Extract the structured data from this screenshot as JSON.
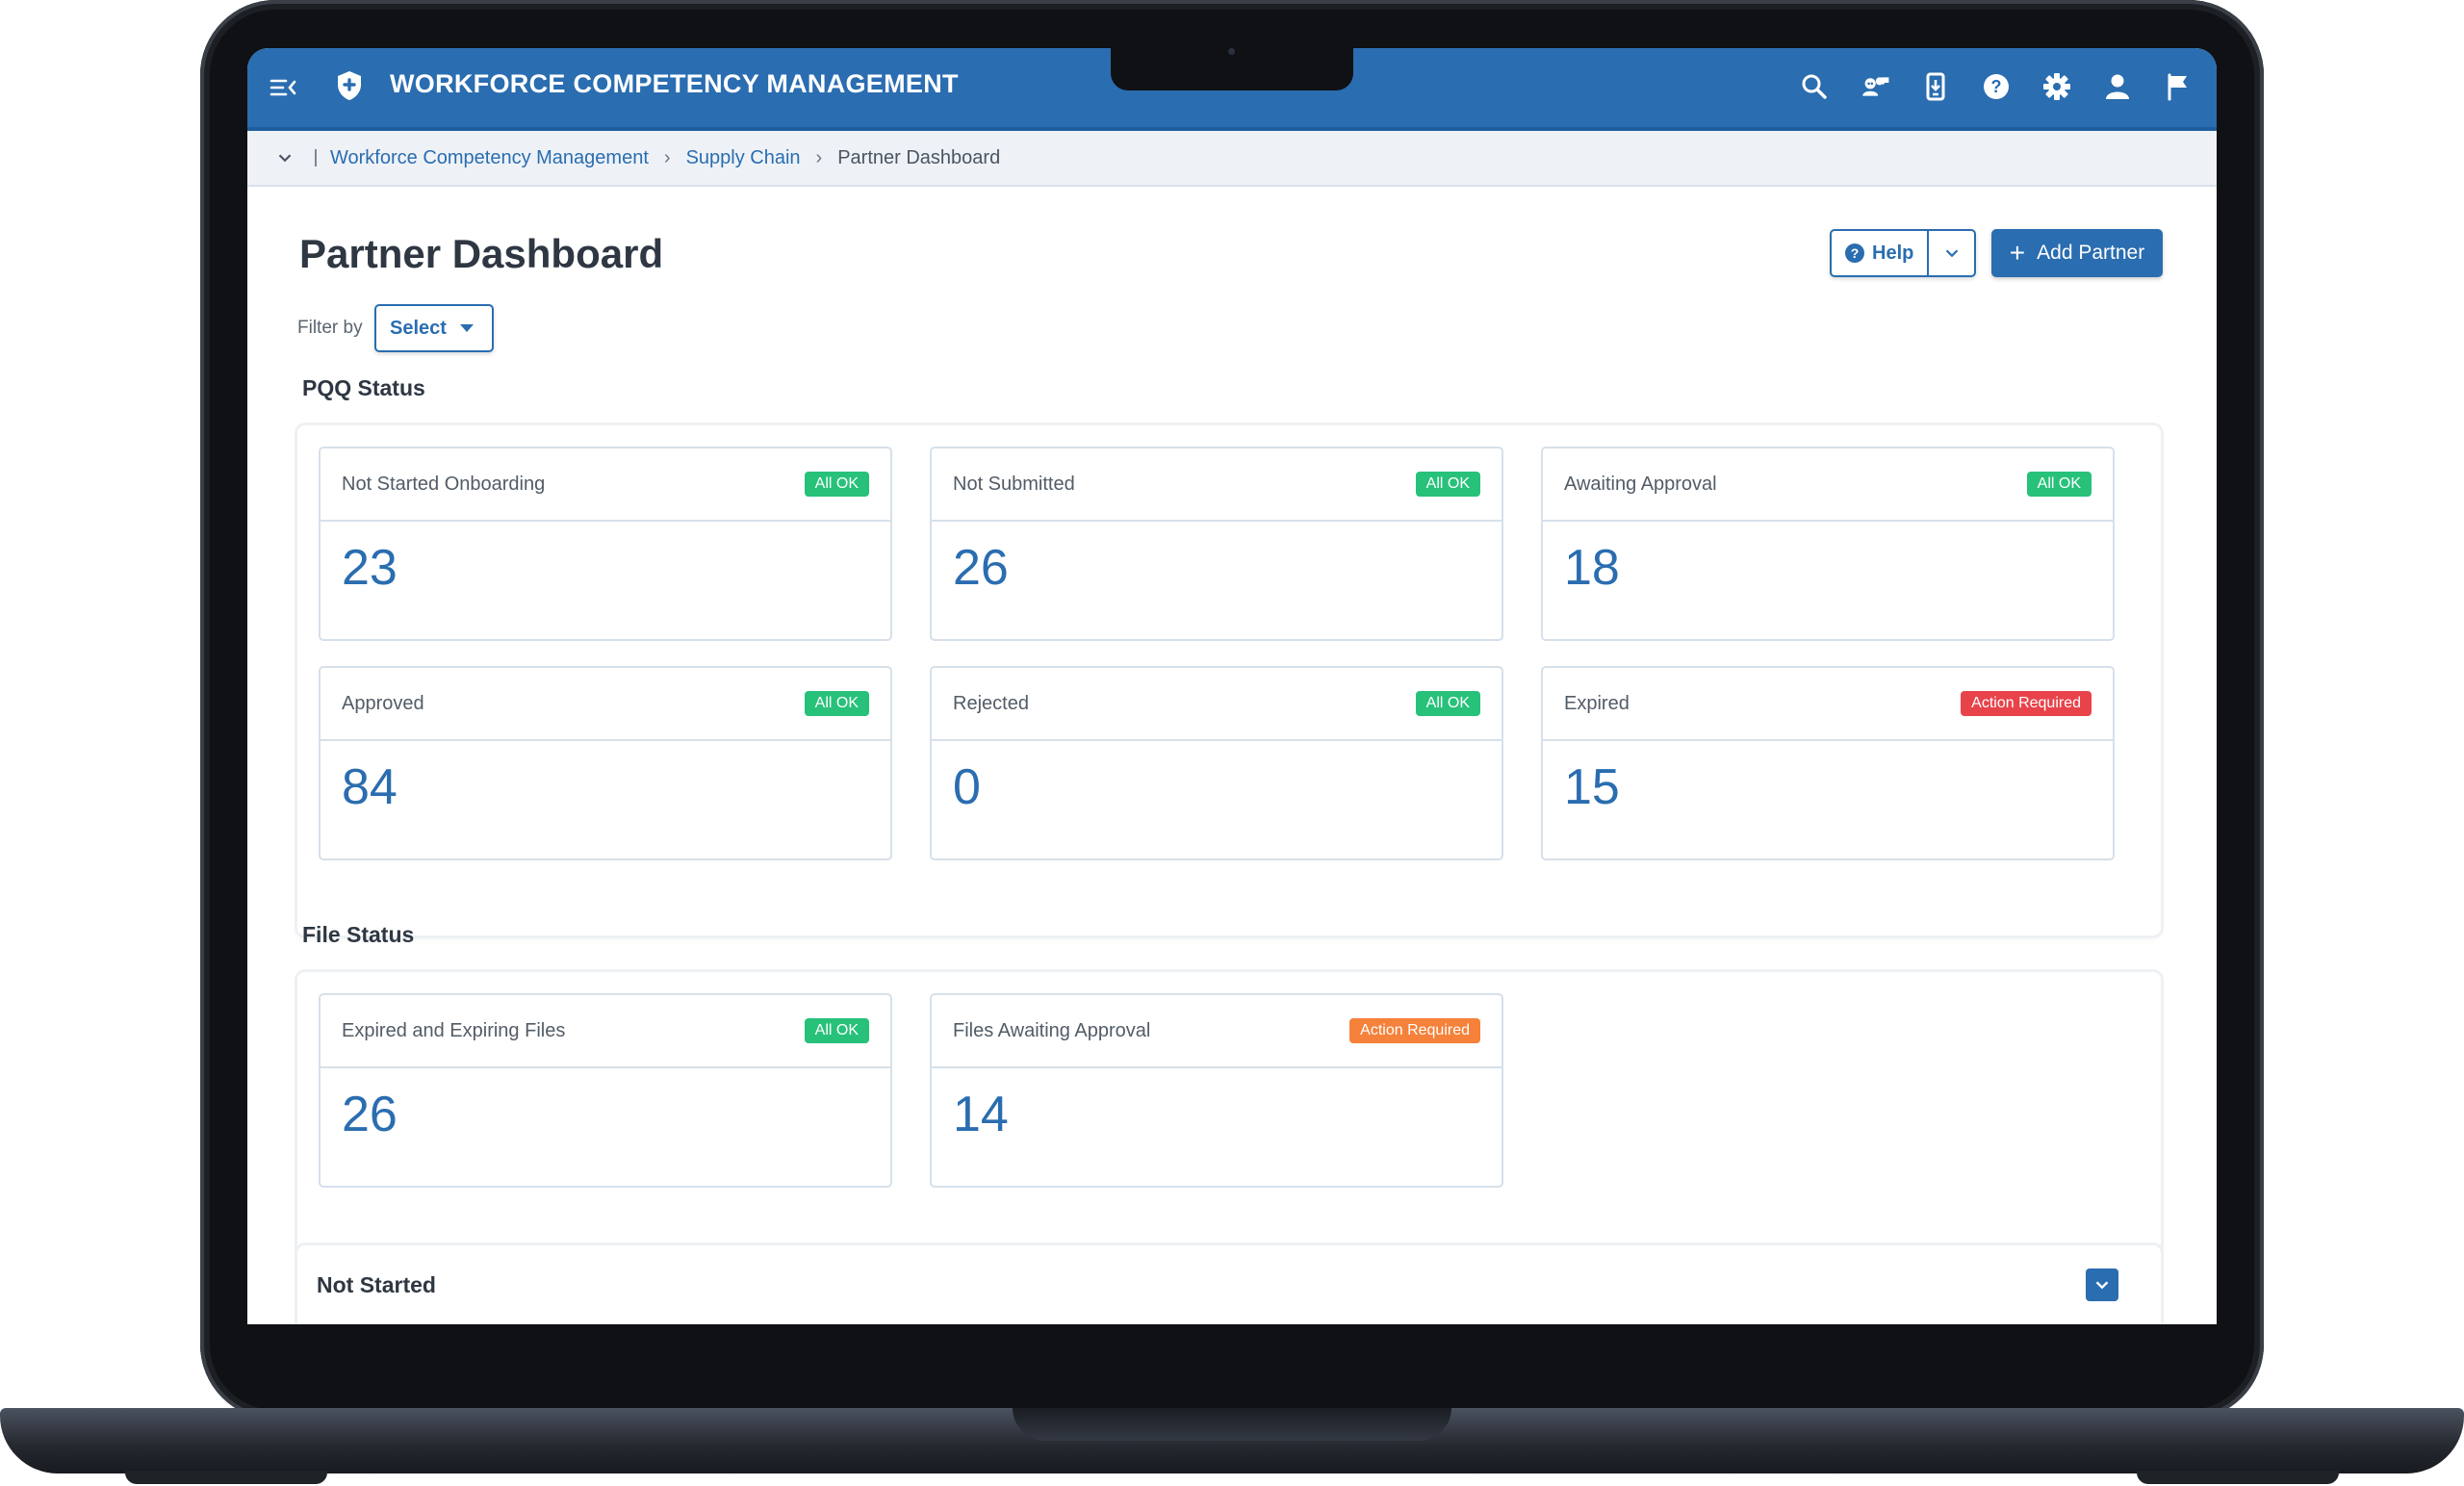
{
  "app": {
    "title": "WORKFORCE COMPETENCY MANAGEMENT"
  },
  "topbar": {
    "icons": [
      "search-icon",
      "users-chat-icon",
      "mobile-device-icon",
      "help-icon",
      "gear-icon",
      "user-icon",
      "flag-icon"
    ]
  },
  "breadcrumb": {
    "items": [
      "Workforce Competency Management",
      "Supply Chain"
    ],
    "current": "Partner Dashboard"
  },
  "page": {
    "title": "Partner Dashboard",
    "help_label": "Help",
    "add_label": "Add Partner",
    "filter_label": "Filter by",
    "filter_value": "Select"
  },
  "pqq": {
    "title": "PQQ Status",
    "cards": [
      {
        "label": "Not Started Onboarding",
        "value": "23",
        "badge": "All OK"
      },
      {
        "label": "Not Submitted",
        "value": "26",
        "badge": "All OK"
      },
      {
        "label": "Awaiting Approval",
        "value": "18",
        "badge": "All OK"
      },
      {
        "label": "Approved",
        "value": "84",
        "badge": "All OK"
      },
      {
        "label": "Rejected",
        "value": "0",
        "badge": "All OK"
      },
      {
        "label": "Expired",
        "value": "15",
        "badge": "Action Required"
      }
    ]
  },
  "files": {
    "title": "File Status",
    "cards": [
      {
        "label": "Expired and Expiring Files",
        "value": "26",
        "badge": "All OK"
      },
      {
        "label": "Files Awaiting Approval",
        "value": "14",
        "badge": "Action Required"
      }
    ]
  },
  "not_started": {
    "title": "Not Started"
  },
  "colors": {
    "brand": "#2a6db0",
    "ok": "#27c17a",
    "danger": "#e8434b",
    "warning": "#f5813a"
  }
}
